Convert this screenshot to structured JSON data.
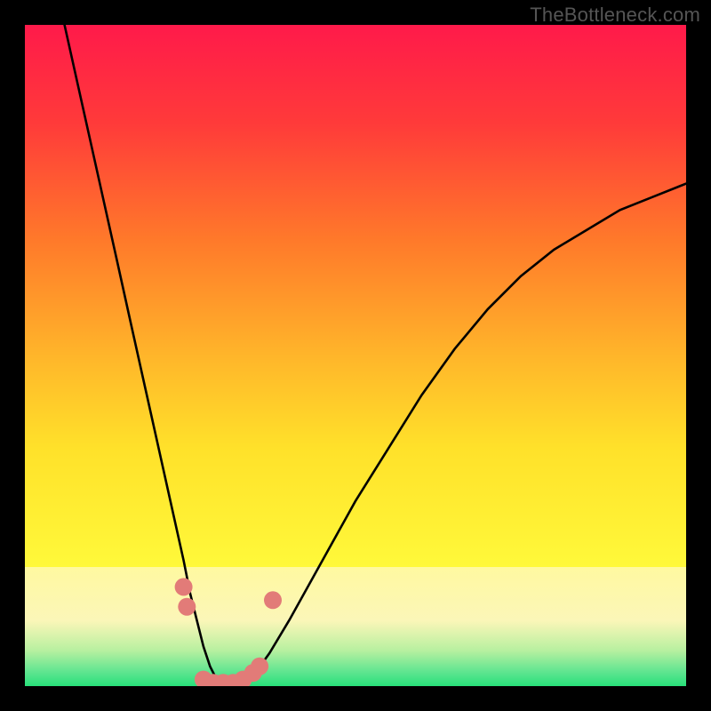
{
  "watermark": "TheBottleneck.com",
  "chart_data": {
    "type": "line",
    "title": "",
    "xlabel": "",
    "ylabel": "",
    "xlim": [
      0,
      100
    ],
    "ylim": [
      0,
      100
    ],
    "grid": false,
    "legend": false,
    "background_gradient": {
      "top_color": "#ff1a4a",
      "mid_upper_color": "#ff7a2a",
      "mid_color": "#ffe12a",
      "lower_band_color": "#fff9a0",
      "bottom_color": "#28e07a"
    },
    "series": [
      {
        "name": "curve",
        "color": "#000000",
        "x": [
          6,
          8,
          10,
          12,
          14,
          16,
          18,
          20,
          22,
          24,
          25,
          26,
          27,
          28,
          29,
          30,
          31,
          32,
          33,
          34,
          35,
          37,
          40,
          45,
          50,
          55,
          60,
          65,
          70,
          75,
          80,
          85,
          90,
          95,
          100
        ],
        "values": [
          100,
          91,
          82,
          73,
          64,
          55,
          46,
          37,
          28,
          19,
          14,
          10,
          6,
          3,
          1,
          0,
          0,
          0,
          0.5,
          1.2,
          2.2,
          5,
          10,
          19,
          28,
          36,
          44,
          51,
          57,
          62,
          66,
          69,
          72,
          74,
          76
        ]
      }
    ],
    "markers": [
      {
        "x": 24.0,
        "y": 15.0
      },
      {
        "x": 24.5,
        "y": 12.0
      },
      {
        "x": 27.0,
        "y": 1.0
      },
      {
        "x": 28.5,
        "y": 0.5
      },
      {
        "x": 30.0,
        "y": 0.5
      },
      {
        "x": 31.5,
        "y": 0.5
      },
      {
        "x": 33.0,
        "y": 1.0
      },
      {
        "x": 34.5,
        "y": 2.0
      },
      {
        "x": 35.5,
        "y": 3.0
      },
      {
        "x": 37.5,
        "y": 13.0
      }
    ],
    "marker_style": {
      "color": "#e27b78",
      "size": 10
    }
  }
}
